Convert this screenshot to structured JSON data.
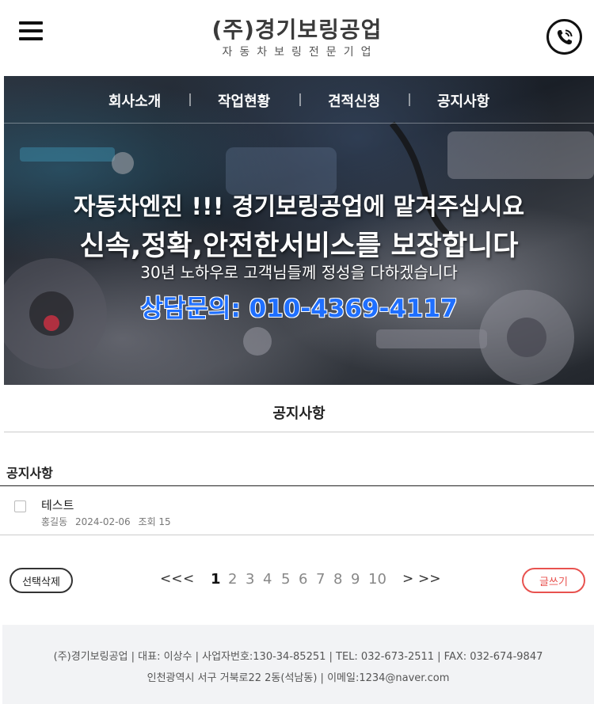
{
  "header": {
    "logo_title": "(주)경기보링공업",
    "logo_subtitle": "자동차보링전문기업",
    "menu_icon": "hamburger-menu-icon",
    "phone_icon": "phone-call-icon"
  },
  "nav": {
    "items": [
      "회사소개",
      "작업현황",
      "견적신청",
      "공지사항"
    ]
  },
  "hero": {
    "line1": "자동차엔진 !!! 경기보링공업에 맡겨주십시요",
    "line2": "신속,정확,안전한서비스를 보장합니다",
    "line3": "30년 노하우로 고객님들께 정성을 다하겠습니다",
    "line4": "상담문의: 010-4369-4117"
  },
  "board": {
    "page_title": "공지사항",
    "board_title": "공지사항",
    "posts": [
      {
        "subject": "테스트",
        "author": "홍길동",
        "date": "2024-02-06",
        "views": "조회 15"
      }
    ],
    "delete_button": "선택삭제",
    "write_button": "글쓰기",
    "pagination": {
      "first": "<<",
      "prev": "<",
      "pages": [
        "1",
        "2",
        "3",
        "4",
        "5",
        "6",
        "7",
        "8",
        "9",
        "10"
      ],
      "current": "1",
      "next": ">",
      "last": ">>"
    }
  },
  "footer": {
    "line1": "(주)경기보링공업   |  대표: 이상수  |  사업자번호:130-34-85251  |  TEL: 032-673-2511  |  FAX: 032-674-9847",
    "line2": "인천광역시 서구 거북로22 2동(석남동)   |  이메일:1234@naver.com"
  },
  "colors": {
    "accent_blue": "#1f6fff",
    "write_red": "#e8524f",
    "footer_bg": "#f2f3f5"
  }
}
